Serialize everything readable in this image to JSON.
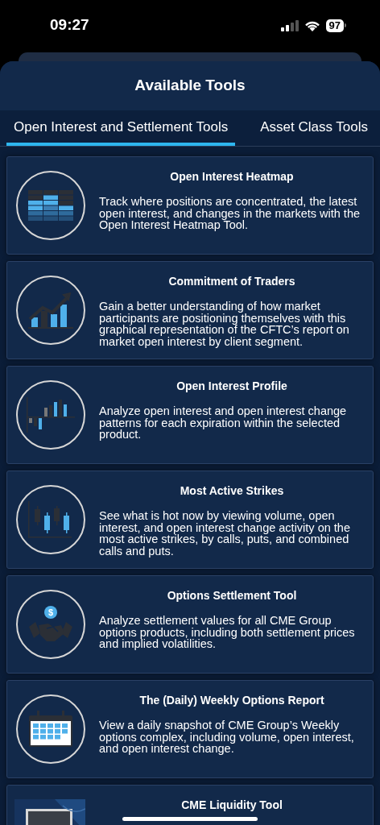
{
  "status_bar": {
    "time": "09:27",
    "battery": "97"
  },
  "header": {
    "title": "Available Tools"
  },
  "tabs": [
    {
      "label": "Open Interest and Settlement Tools",
      "selected": true
    },
    {
      "label": "Asset Class Tools",
      "selected": false
    }
  ],
  "tools": [
    {
      "kind": "heatmap",
      "title": "Open Interest Heatmap",
      "description": "Track where positions are concentrated, the latest open interest, and changes in the markets with the Open Interest Heatmap Tool."
    },
    {
      "kind": "growth",
      "title": "Commitment of Traders",
      "description": "Gain a better understanding of how market participants are positioning themselves with this graphical representation of the CFTC’s report on market open interest by client segment."
    },
    {
      "kind": "profile",
      "title": "Open Interest Profile",
      "description": "Analyze open interest and open interest change patterns for each expiration within the selected product."
    },
    {
      "kind": "candles",
      "title": "Most Active Strikes",
      "description": "See what is hot now by viewing volume, open interest, and open interest change activity on the most active strikes, by calls, puts, and combined calls and puts."
    },
    {
      "kind": "handshake",
      "title": "Options Settlement Tool",
      "description": "Analyze settlement values for all CME Group options products, including both settlement prices and implied volatilities.",
      "badge": "$"
    },
    {
      "kind": "calendar",
      "title": "The (Daily) Weekly Options Report",
      "description": "View a daily snapshot of CME Group’s Weekly options complex, including volume, open interest, and open interest change."
    },
    {
      "kind": "picture",
      "title": "CME Liquidity Tool"
    }
  ]
}
